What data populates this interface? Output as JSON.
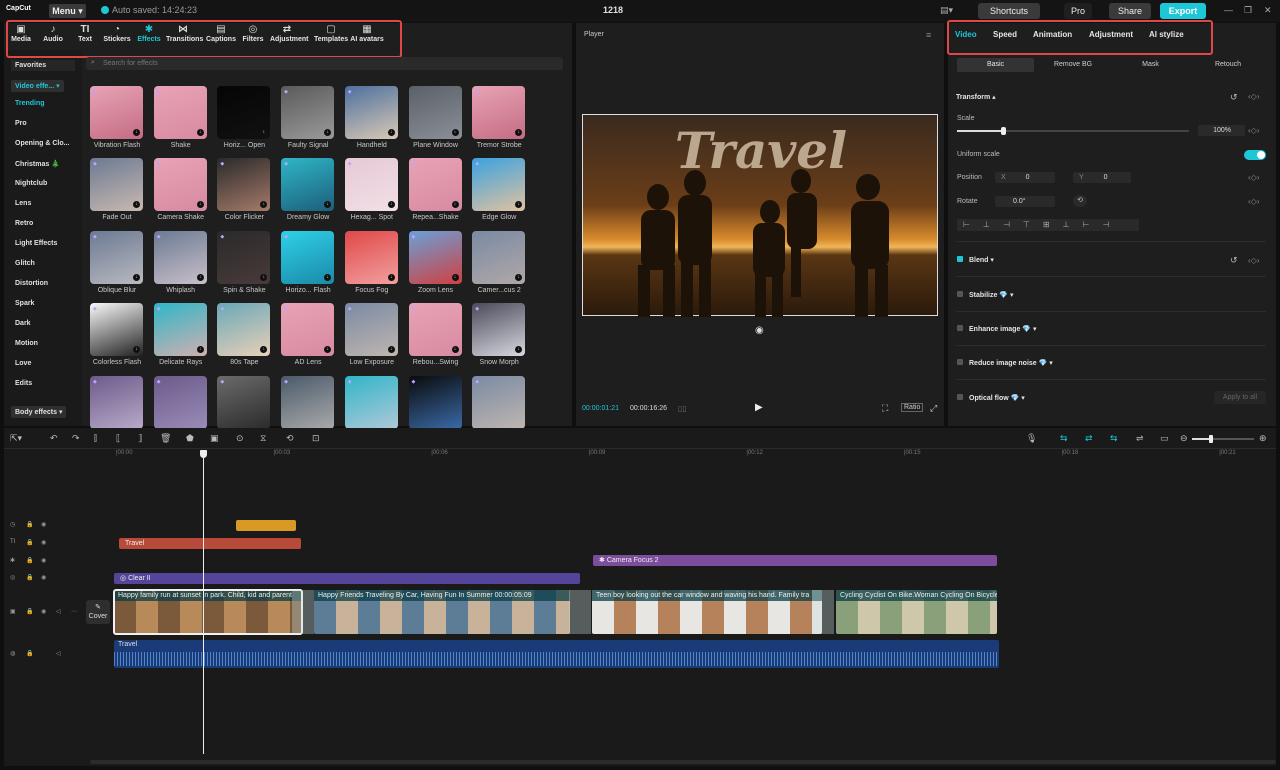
{
  "titlebar": {
    "logo": "CapCut",
    "menu": "Menu ▾",
    "autosave": "Auto saved: 14:24:23",
    "project": "1218",
    "shortcuts": "Shortcuts",
    "pro": "Pro",
    "share": "Share",
    "export": "Export"
  },
  "media_tabs": [
    "Media",
    "Audio",
    "Text",
    "Stickers",
    "Effects",
    "Transitions",
    "Captions",
    "Filters",
    "Adjustment",
    "Templates",
    "AI avatars"
  ],
  "media_icons": [
    "▣",
    "♪",
    "TI",
    "◔",
    "✱",
    "⋈",
    "▤",
    "◎",
    "⇄",
    "▢",
    "▦"
  ],
  "categories": [
    "Favorites",
    "Video effe... ▾",
    "Trending",
    "Pro",
    "Opening & Clo...",
    "Christmas 🎄",
    "Nightclub",
    "Lens",
    "Retro",
    "Light Effects",
    "Glitch",
    "Distortion",
    "Spark",
    "Dark",
    "Motion",
    "Love",
    "Edits",
    "Body effects ▾"
  ],
  "search_placeholder": "Search for effects",
  "effects": [
    "Vibration Flash",
    "Shake",
    "Horiz... Open",
    "Faulty Signal",
    "Handheld",
    "Plane Window",
    "Tremor Strobe",
    "Fade Out",
    "Camera Shake",
    "Color Flicker",
    "Dreamy Glow",
    "Hexag... Spot",
    "Repea...Shake",
    "Edge Glow",
    "Oblique Blur",
    "Whiplash",
    "Spin & Shake",
    "Horizo... Flash",
    "Focus Fog",
    "Zoom Lens",
    "Camer...cus 2",
    "Colorless Flash",
    "Delicate Rays",
    "80s Tape",
    "AD Lens",
    "Low Exposure",
    "Rebou...Swing",
    "Snow Morph",
    "",
    "",
    "",
    "",
    "",
    "",
    ""
  ],
  "player": {
    "title": "Player",
    "overlay_text": "Travel",
    "current_time": "00:00:01:21",
    "total_time": "00:00:16:26",
    "ratio": "Ratio"
  },
  "props": {
    "tabs": [
      "Video",
      "Speed",
      "Animation",
      "Adjustment",
      "AI stylize"
    ],
    "subtabs": [
      "Basic",
      "Remove BG",
      "Mask",
      "Retouch"
    ],
    "transform": "Transform ▴",
    "scale_label": "Scale",
    "scale_value": "100%",
    "scale_level": 0.3,
    "uniform_scale": "Uniform scale",
    "position_label": "Position",
    "pos_x_label": "X",
    "pos_x": "0",
    "pos_y_label": "Y",
    "pos_y": "0",
    "rotate_label": "Rotate",
    "rotate_value": "0.0°",
    "blend": "Blend ▾",
    "stabilize": "Stabilize 💎 ▾",
    "enhance": "Enhance image 💎 ▾",
    "noise": "Reduce image noise 💎 ▾",
    "optical": "Optical flow 💎 ▾",
    "apply_all": "Apply to all"
  },
  "timeline": {
    "ruler": [
      "|00:00",
      "|00:03",
      "|00:06",
      "|00:09",
      "|00:12",
      "|00:15",
      "|00:18",
      "|00:21"
    ],
    "text_clip": "Travel",
    "effect_clip": "Camera Focus 2",
    "filter_clip": "Clear II",
    "cover_label": "Cover",
    "video_clips": [
      "Happy family run at sunset in park. Child, kid and parent",
      "Happy Friends Traveling By Car, Having Fun In Summer  00:00:05:09",
      "Teen boy looking out the car window and waving his hand. Family tra",
      "Cycling Cyclist On Bike.Woman Cycling On Bicycle"
    ],
    "audio_clip": "Travel"
  },
  "colors": {
    "accent": "#1ec7d6",
    "highlight_box": "#e04848",
    "text_track": "#b84a3a",
    "effect_track": "#7c4d9c",
    "filter_track": "#55459a",
    "sticker_track": "#d99a25",
    "audio_track": "#1a3b78"
  }
}
